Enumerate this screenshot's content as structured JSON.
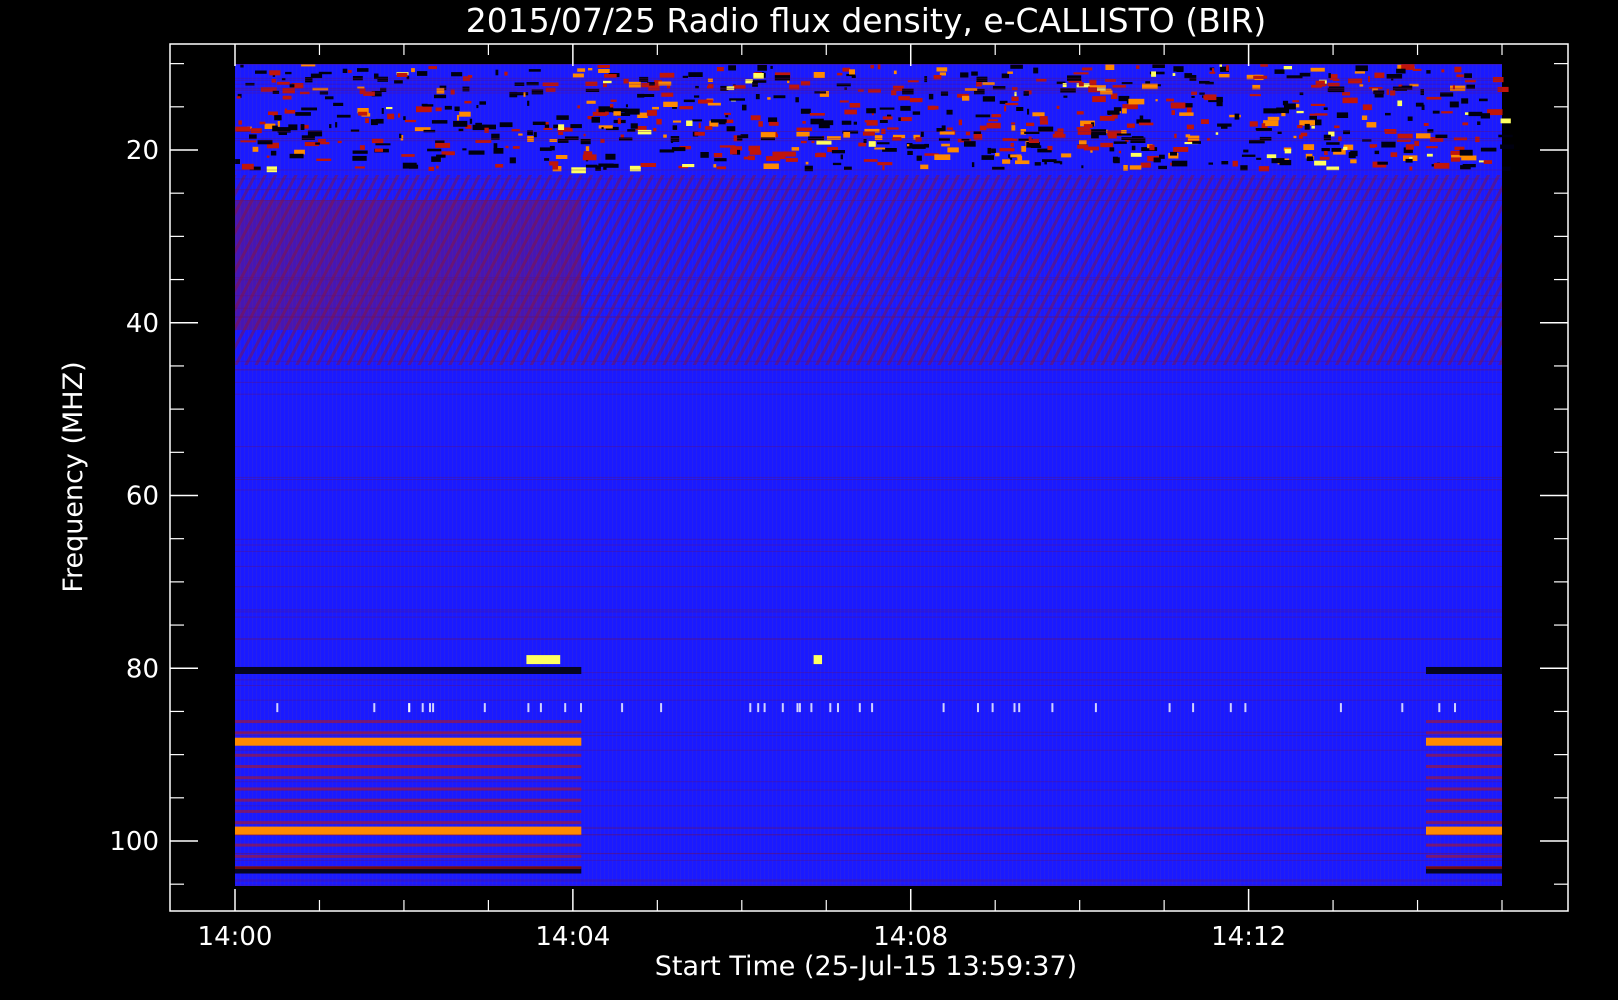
{
  "chart_data": {
    "type": "heatmap",
    "title": "2015/07/25  Radio flux density, e-CALLISTO (BIR)",
    "xlabel": "Start Time (25-Jul-15 13:59:37)",
    "ylabel": "Frequency (MHZ)",
    "x_ticks": [
      "14:00",
      "14:04",
      "14:08",
      "14:12"
    ],
    "y_ticks": [
      20,
      40,
      60,
      80,
      100
    ],
    "ylim": [
      10,
      107
    ],
    "y_inverted": true,
    "x_range_minutes_after_1400": [
      0,
      15
    ],
    "colors": {
      "background": "#000000",
      "low": "#1a1aff",
      "mid": "#c0150a",
      "high": "#ff8a00",
      "max": "#ffff60"
    },
    "features": [
      {
        "name": "rfi-band",
        "freq_mhz": 88.5,
        "start_min": 0,
        "end_min": 4.1,
        "intensity": "high"
      },
      {
        "name": "rfi-band",
        "freq_mhz": 98.8,
        "start_min": 0,
        "end_min": 4.1,
        "intensity": "high"
      },
      {
        "name": "rfi-band",
        "freq_mhz": 88.5,
        "start_min": 14.1,
        "end_min": 15,
        "intensity": "high"
      },
      {
        "name": "rfi-band",
        "freq_mhz": 98.8,
        "start_min": 14.1,
        "end_min": 15,
        "intensity": "high"
      },
      {
        "name": "burst",
        "freq_mhz": 79,
        "start_min": 3.45,
        "end_min": 3.85,
        "intensity": "max"
      },
      {
        "name": "burst",
        "freq_mhz": 79,
        "start_min": 6.85,
        "end_min": 6.95,
        "intensity": "max"
      }
    ]
  }
}
